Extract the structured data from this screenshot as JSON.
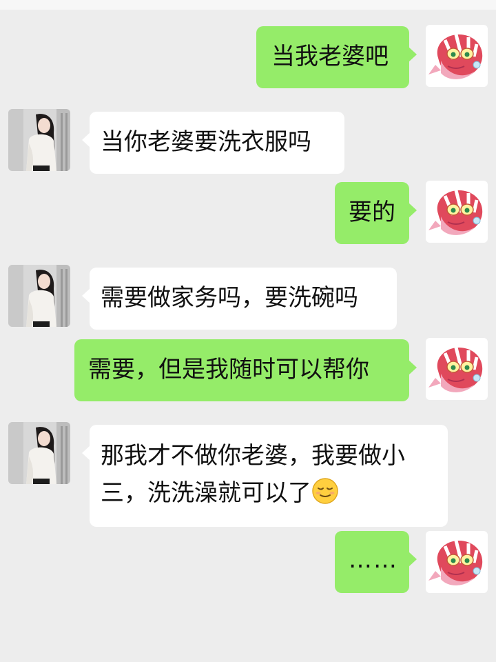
{
  "messages": [
    {
      "side": "out",
      "text": "当我老婆吧"
    },
    {
      "side": "in",
      "text": "当你老婆要洗衣服吗"
    },
    {
      "side": "out",
      "text": "要的"
    },
    {
      "side": "in",
      "text": "需要做家务吗，要洗碗吗"
    },
    {
      "side": "out",
      "text": "需要，但是我随时可以帮你"
    },
    {
      "side": "in",
      "line1": "那我才不做你老婆，我要做小",
      "line2": "三，洗洗澡就可以了",
      "emoji": "relieved-face-emoji"
    },
    {
      "side": "out",
      "text": "……"
    }
  ],
  "colors": {
    "background": "#ededed",
    "incoming_bubble": "#ffffff",
    "outgoing_bubble": "#95ec69"
  },
  "icons": {
    "self_avatar": "cartoon-fish-avatar",
    "contact_avatar": "contact-photo-avatar"
  }
}
